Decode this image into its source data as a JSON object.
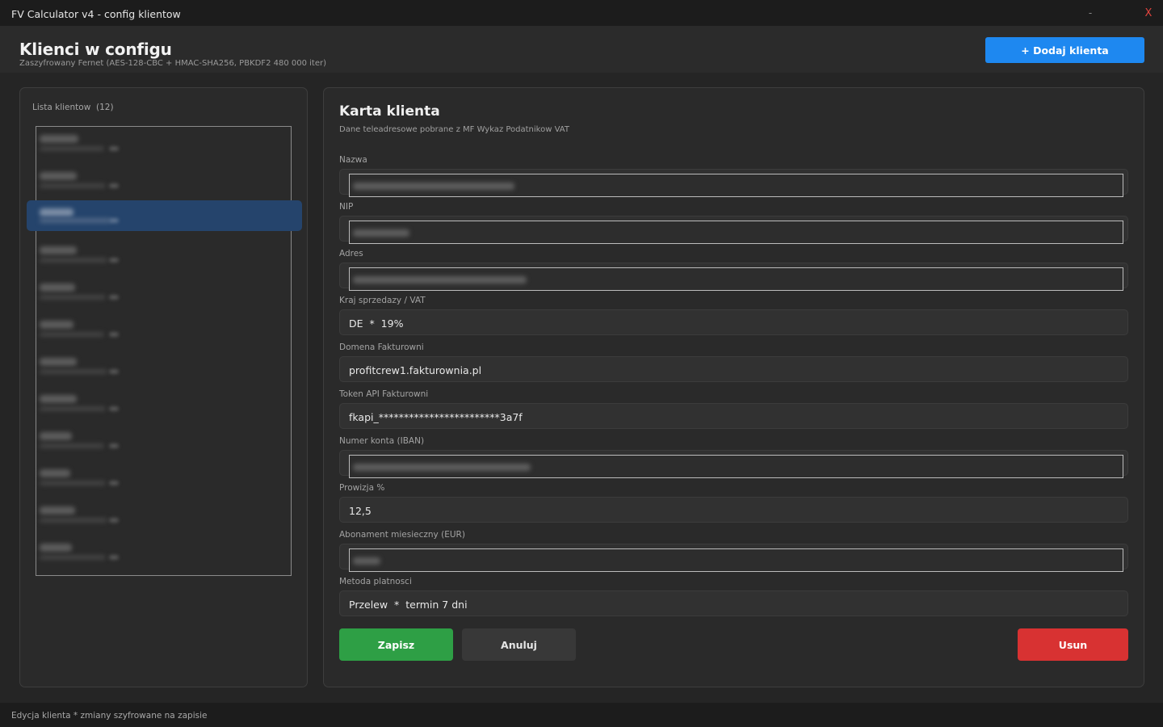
{
  "window": {
    "title": "FV Calculator v4 - config klientow",
    "minimize": "-",
    "close": "X"
  },
  "header": {
    "title": "Klienci w configu",
    "subtitle": "Zaszyfrowany Fernet (AES-128-CBC + HMAC-SHA256, PBKDF2 480 000 iter)",
    "add_button": "+ Dodaj klienta",
    "accent_color": "#1e88f0"
  },
  "client_list": {
    "label": "Lista klientow",
    "count": "(12)",
    "item_count": 12,
    "selected_index": 2,
    "items_redacted": true
  },
  "card": {
    "title": "Karta klienta",
    "description": "Dane teleadresowe pobrane z MF Wykaz Podatnikow VAT",
    "fields": {
      "nazwa": {
        "label": "Nazwa",
        "value": "",
        "redacted": true
      },
      "nip": {
        "label": "NIP",
        "value": "",
        "redacted": true
      },
      "adres": {
        "label": "Adres",
        "value": "",
        "redacted": true
      },
      "kraj": {
        "label": "Kraj sprzedazy / VAT",
        "value": "DE  *  19%"
      },
      "domena": {
        "label": "Domena Fakturowni",
        "value": "profitcrew1.fakturownia.pl"
      },
      "token": {
        "label": "Token API Fakturowni",
        "value": "fkapi_************************3a7f"
      },
      "iban": {
        "label": "Numer konta (IBAN)",
        "value": "",
        "redacted": true
      },
      "prowizja": {
        "label": "Prowizja %",
        "value": "12,5"
      },
      "abonament": {
        "label": "Abonament miesieczny (EUR)",
        "value": "",
        "redacted": true
      },
      "metoda": {
        "label": "Metoda platnosci",
        "value": "Przelew  *  termin 7 dni"
      }
    },
    "buttons": {
      "save": "Zapisz",
      "cancel": "Anuluj",
      "delete": "Usun"
    },
    "colors": {
      "save": "#2e9f45",
      "delete": "#d83232"
    }
  },
  "status": {
    "text": "Edycja klienta * zmiany szyfrowane na zapisie"
  }
}
